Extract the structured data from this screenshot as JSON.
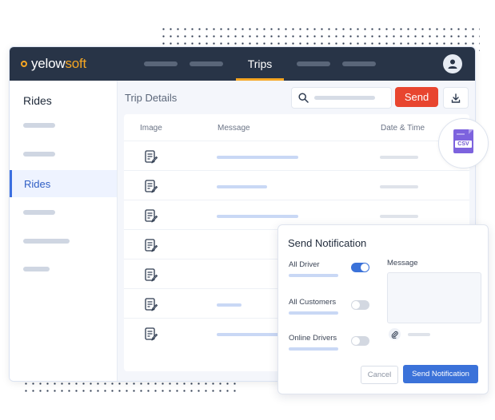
{
  "app": {
    "logo_part1": "yelow",
    "logo_part2": "soft"
  },
  "nav": {
    "active_tab": "Trips"
  },
  "sidebar": {
    "title": "Rides",
    "active_item": "Rides"
  },
  "main": {
    "title": "Trip Details",
    "send_label": "Send",
    "columns": {
      "image": "Image",
      "message": "Message",
      "date": "Date & Time"
    },
    "csv_label": "CSV"
  },
  "notification": {
    "title": "Send Notification",
    "options": [
      {
        "label": "All Driver",
        "enabled": true
      },
      {
        "label": "All Customers",
        "enabled": false
      },
      {
        "label": "Online Drivers",
        "enabled": false
      }
    ],
    "message_label": "Message",
    "cancel_label": "Cancel",
    "send_label": "Send Notification"
  },
  "colors": {
    "navbar": "#283447",
    "brand": "#f5a623",
    "send": "#e8452f",
    "primary": "#3b72d9",
    "csv": "#7d63de"
  },
  "icons": [
    "user-icon",
    "search-icon",
    "download-icon",
    "document-edit-icon",
    "csv-file-icon",
    "paperclip-icon"
  ]
}
